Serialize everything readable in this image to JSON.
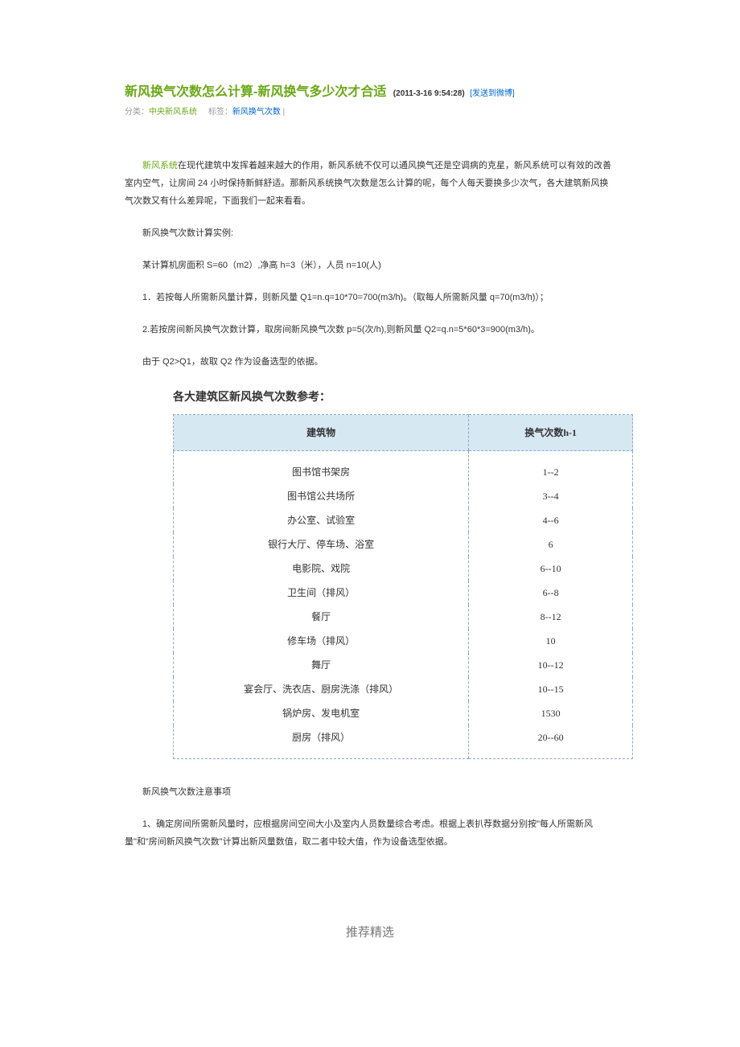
{
  "header": {
    "title_main": "新风换气次数怎么计算-新风换气多少次才合适",
    "title_date": "(2011-3-16 9:54:28)",
    "title_link": "[发送到微博]"
  },
  "meta": {
    "label_category": "分类：",
    "category": "中央新风系统",
    "label_tag": "标签：",
    "tag": "新风换气次数",
    "separator": " |"
  },
  "content": {
    "intro_link": "新风系统",
    "intro_rest": "在现代建筑中发挥着越来越大的作用，新风系统不仅可以通风换气还是空调病的克星，新风系统可以有效的改善室内空气，让房间 24 小时保持新鲜舒适。那新风系统换气次数是怎么计算的呢，每个人每天要换多少次气，各大建筑新风换气次数又有什么差异呢，下面我们一起来看看。",
    "example_label": "新风换气次数计算实例:",
    "example_setup": "某计算机房面积 S=60（m2）,净高 h=3（米），人员 n=10(人)",
    "calc1": "1．若按每人所需新风量计算，则新风量 Q1=n.q=10*70=700(m3/h)。（取每人所需新风量 q=70(m3/h)）；",
    "calc2": "2.若按房间新风换气次数计算，取房间新风换气次数 p=5(次/h),则新风量 Q2=q.n=5*60*3=900(m3/h)。",
    "conclusion": "由于 Q2>Q1，故取 Q2 作为设备选型的依据。",
    "section_heading": "各大建筑区新风换气次数参考：",
    "notes_label": "新风换气次数注意事项",
    "note1": "1、确定房间所需新风量时，应根据房间空间大小及室内人员数量综合考虑。根据上表扒荐数据分别按\"每人所需新风量\"和\"房间新风换气次数\"计算出新风量数值，取二者中较大值，作为设备选型依据。"
  },
  "chart_data": {
    "type": "table",
    "headers": [
      "建筑物",
      "换气次数h-1"
    ],
    "rows": [
      [
        "图书馆书架房",
        "1--2"
      ],
      [
        "图书馆公共场所",
        "3--4"
      ],
      [
        "办公室、试验室",
        "4--6"
      ],
      [
        "银行大厅、停车场、浴室",
        "6"
      ],
      [
        "电影院、戏院",
        "6--10"
      ],
      [
        "卫生间（排风）",
        "6--8"
      ],
      [
        "餐厅",
        "8--12"
      ],
      [
        "修车场（排风）",
        "10"
      ],
      [
        "舞厅",
        "10--12"
      ],
      [
        "宴会厅、洗衣店、厨房洗涤（排风）",
        "10--15"
      ],
      [
        "锅炉房、发电机室",
        "1530"
      ],
      [
        "厨房（排风）",
        "20--60"
      ]
    ]
  },
  "footer": {
    "text": "推荐精选"
  }
}
